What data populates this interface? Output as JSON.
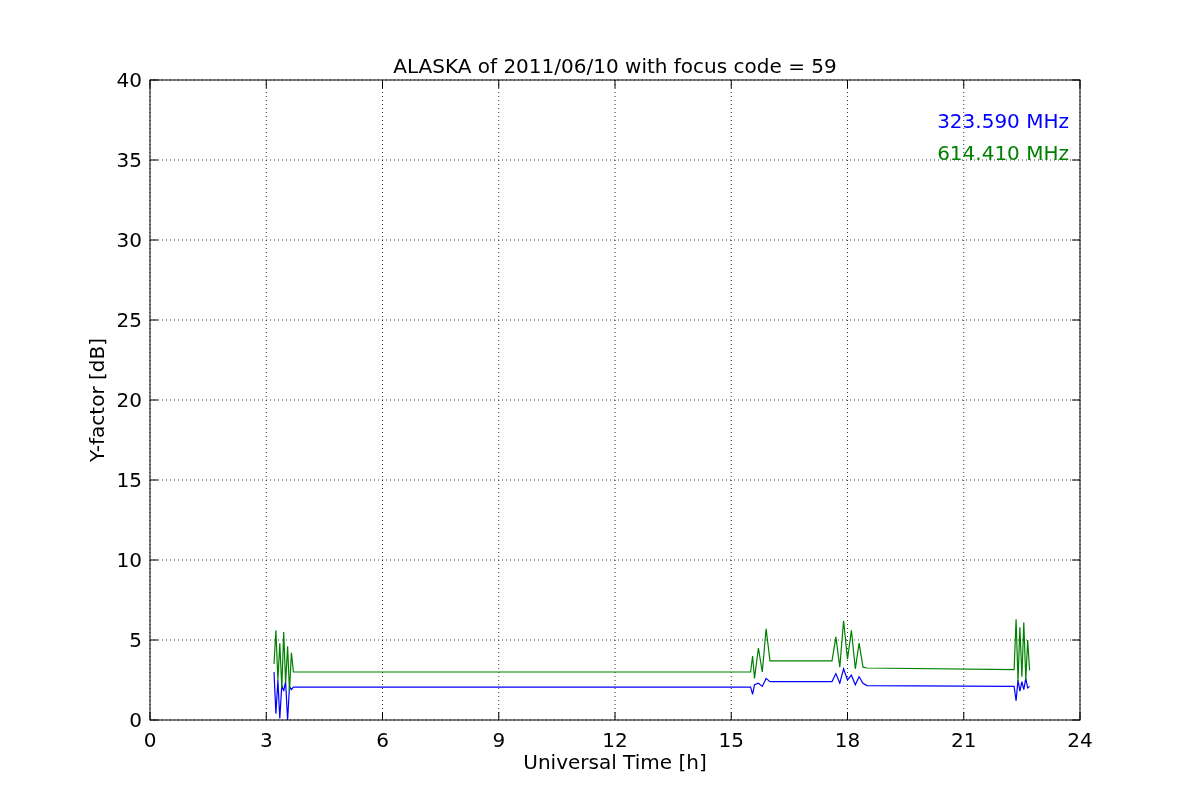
{
  "figure": {
    "chart_data": {
      "type": "line",
      "title": "ALASKA of 2011/06/10 with focus code = 59",
      "xlabel": "Universal Time [h]",
      "ylabel": "Y-factor [dB]",
      "x": [
        3.2,
        3.25,
        3.3,
        3.35,
        3.4,
        3.45,
        3.5,
        3.55,
        3.6,
        3.65,
        3.7,
        15.5,
        15.55,
        15.6,
        15.7,
        15.8,
        15.9,
        16.0,
        17.6,
        17.7,
        17.8,
        17.9,
        18.0,
        18.1,
        18.2,
        18.3,
        18.4,
        18.5,
        22.3,
        22.35,
        22.4,
        22.45,
        22.5,
        22.55,
        22.6,
        22.65,
        22.7
      ],
      "series": [
        {
          "name": "323.590 MHz",
          "color": "#0000ff",
          "values": [
            3.0,
            0.4,
            2.5,
            0.1,
            2.2,
            1.8,
            2.4,
            0,
            2.1,
            1.9,
            2.05,
            2.05,
            1.6,
            2.2,
            2.3,
            2.1,
            2.6,
            2.4,
            2.4,
            2.9,
            2.3,
            3.2,
            2.5,
            2.8,
            2.2,
            2.7,
            2.3,
            2.15,
            2.1,
            1.2,
            2.5,
            1.8,
            2.4,
            1.9,
            2.6,
            2.0,
            2.1
          ]
        },
        {
          "name": "614.410 MHz",
          "color": "#008000",
          "values": [
            3.5,
            5.6,
            2.5,
            4.8,
            2.0,
            5.5,
            2.3,
            4.6,
            1.8,
            4.2,
            3.0,
            3.0,
            4.0,
            2.6,
            4.5,
            3.0,
            5.7,
            3.7,
            3.7,
            5.2,
            3.3,
            6.2,
            3.8,
            5.6,
            3.2,
            4.8,
            3.3,
            3.25,
            3.15,
            6.3,
            2.4,
            5.8,
            2.7,
            6.1,
            2.5,
            5.0,
            3.1
          ]
        }
      ],
      "xlim": [
        0,
        24
      ],
      "ylim": [
        0,
        40
      ],
      "xticks": [
        0,
        3,
        6,
        9,
        12,
        15,
        18,
        21,
        24
      ],
      "yticks": [
        0,
        5,
        10,
        15,
        20,
        25,
        30,
        35,
        40
      ],
      "grid": true
    }
  }
}
